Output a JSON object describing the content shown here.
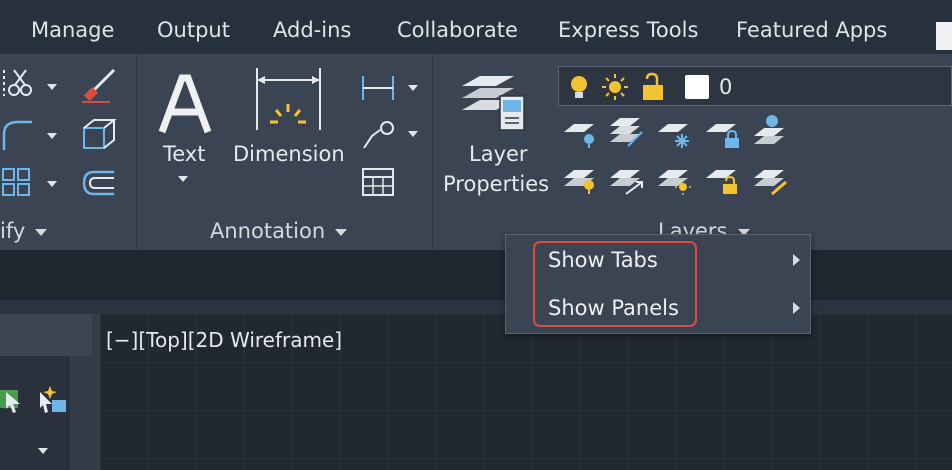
{
  "ribbon_tabs": [
    "Manage",
    "Output",
    "Add-ins",
    "Collaborate",
    "Express Tools",
    "Featured Apps"
  ],
  "panels": {
    "modify_title": "ify",
    "annotation_title": "Annotation",
    "layers_title": "Layers"
  },
  "annotation": {
    "text_label": "Text",
    "dimension_label": "Dimension"
  },
  "layers": {
    "properties_label_line1": "Layer",
    "properties_label_line2": "Properties",
    "current_layer": "0",
    "current_layer_color": "#ffffff"
  },
  "context_menu": {
    "items": [
      {
        "label": "Show Tabs",
        "has_submenu": true
      },
      {
        "label": "Show Panels",
        "has_submenu": true
      }
    ],
    "highlight_color": "#e2493c"
  },
  "viewport": {
    "label": "[−][Top][2D Wireframe]"
  },
  "colors": {
    "ribbon_bg": "#3b4453",
    "tabbar_bg": "#27303d",
    "canvas_bg": "#212830",
    "icon_blue": "#6fb6e8",
    "icon_yellow": "#f2c230"
  }
}
